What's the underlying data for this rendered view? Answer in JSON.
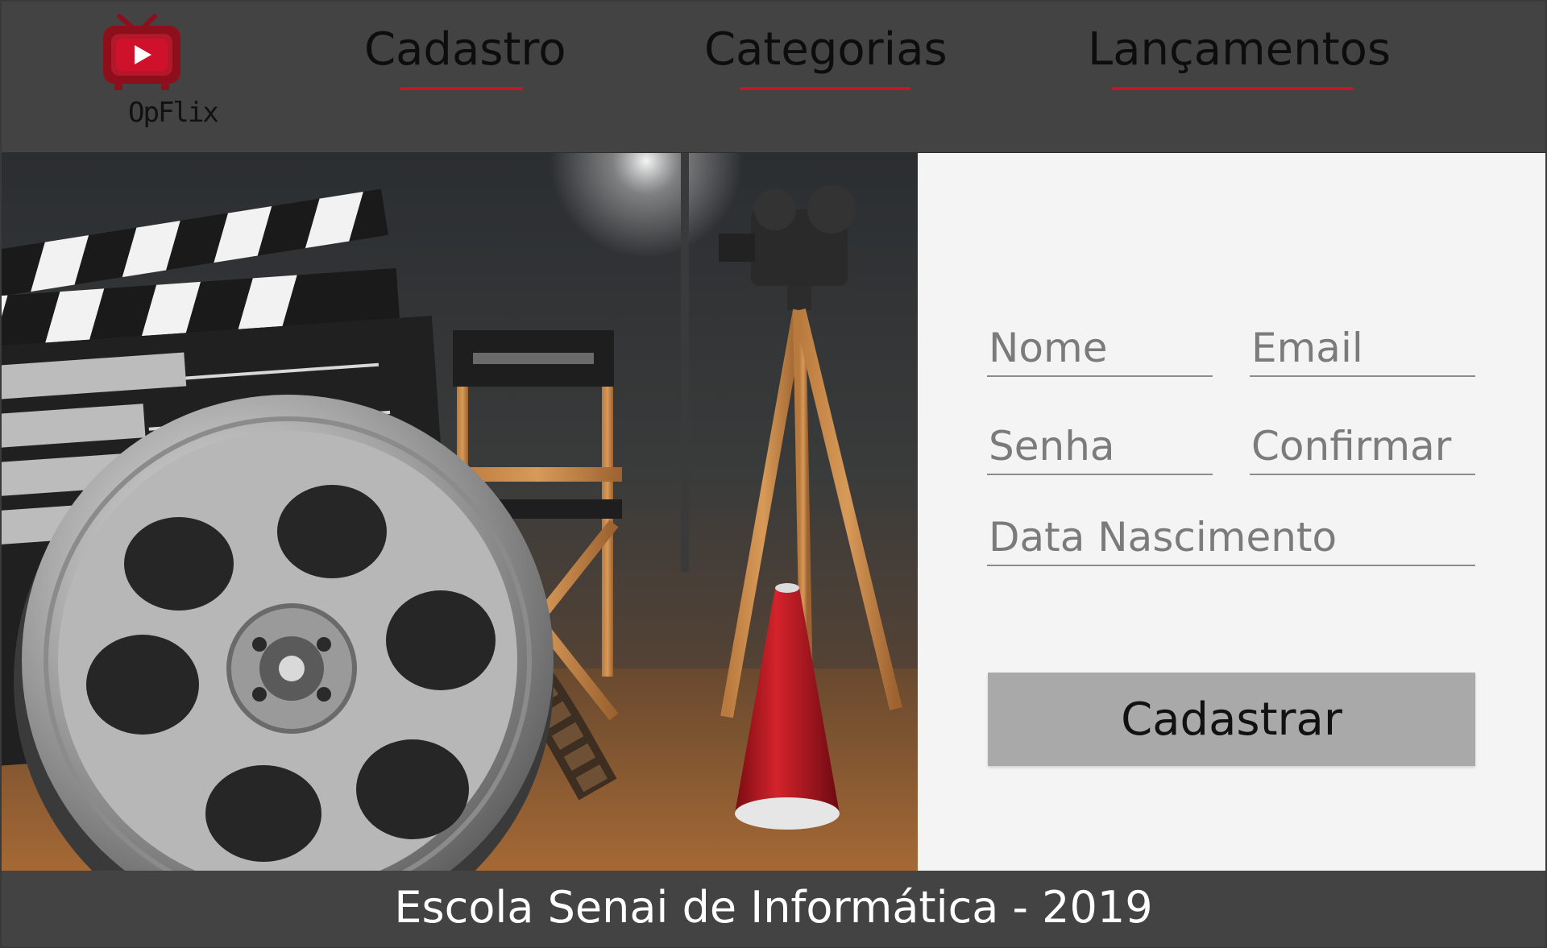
{
  "app": {
    "brand_name": "OpFlix",
    "logo_icon": "tv-play-icon",
    "accent_color": "#d0112b",
    "header_color": "#434343"
  },
  "nav": {
    "items": [
      {
        "label": "Cadastro"
      },
      {
        "label": "Categorias"
      },
      {
        "label": "Lançamentos"
      }
    ]
  },
  "hero": {
    "image_subject": "cinema clapperboard, film reel, director's chair, camera and megaphone"
  },
  "form": {
    "fields": {
      "nome": {
        "placeholder": "Nome",
        "value": ""
      },
      "email": {
        "placeholder": "Email",
        "value": ""
      },
      "senha": {
        "placeholder": "Senha",
        "value": ""
      },
      "confirmar": {
        "placeholder": "Confirmar",
        "value": ""
      },
      "data_nascimento": {
        "placeholder": "Data Nascimento",
        "value": ""
      }
    },
    "submit_label": "Cadastrar",
    "submit_color": "#a9a9a9"
  },
  "footer": {
    "text": "Escola Senai de Informática - 2019"
  }
}
